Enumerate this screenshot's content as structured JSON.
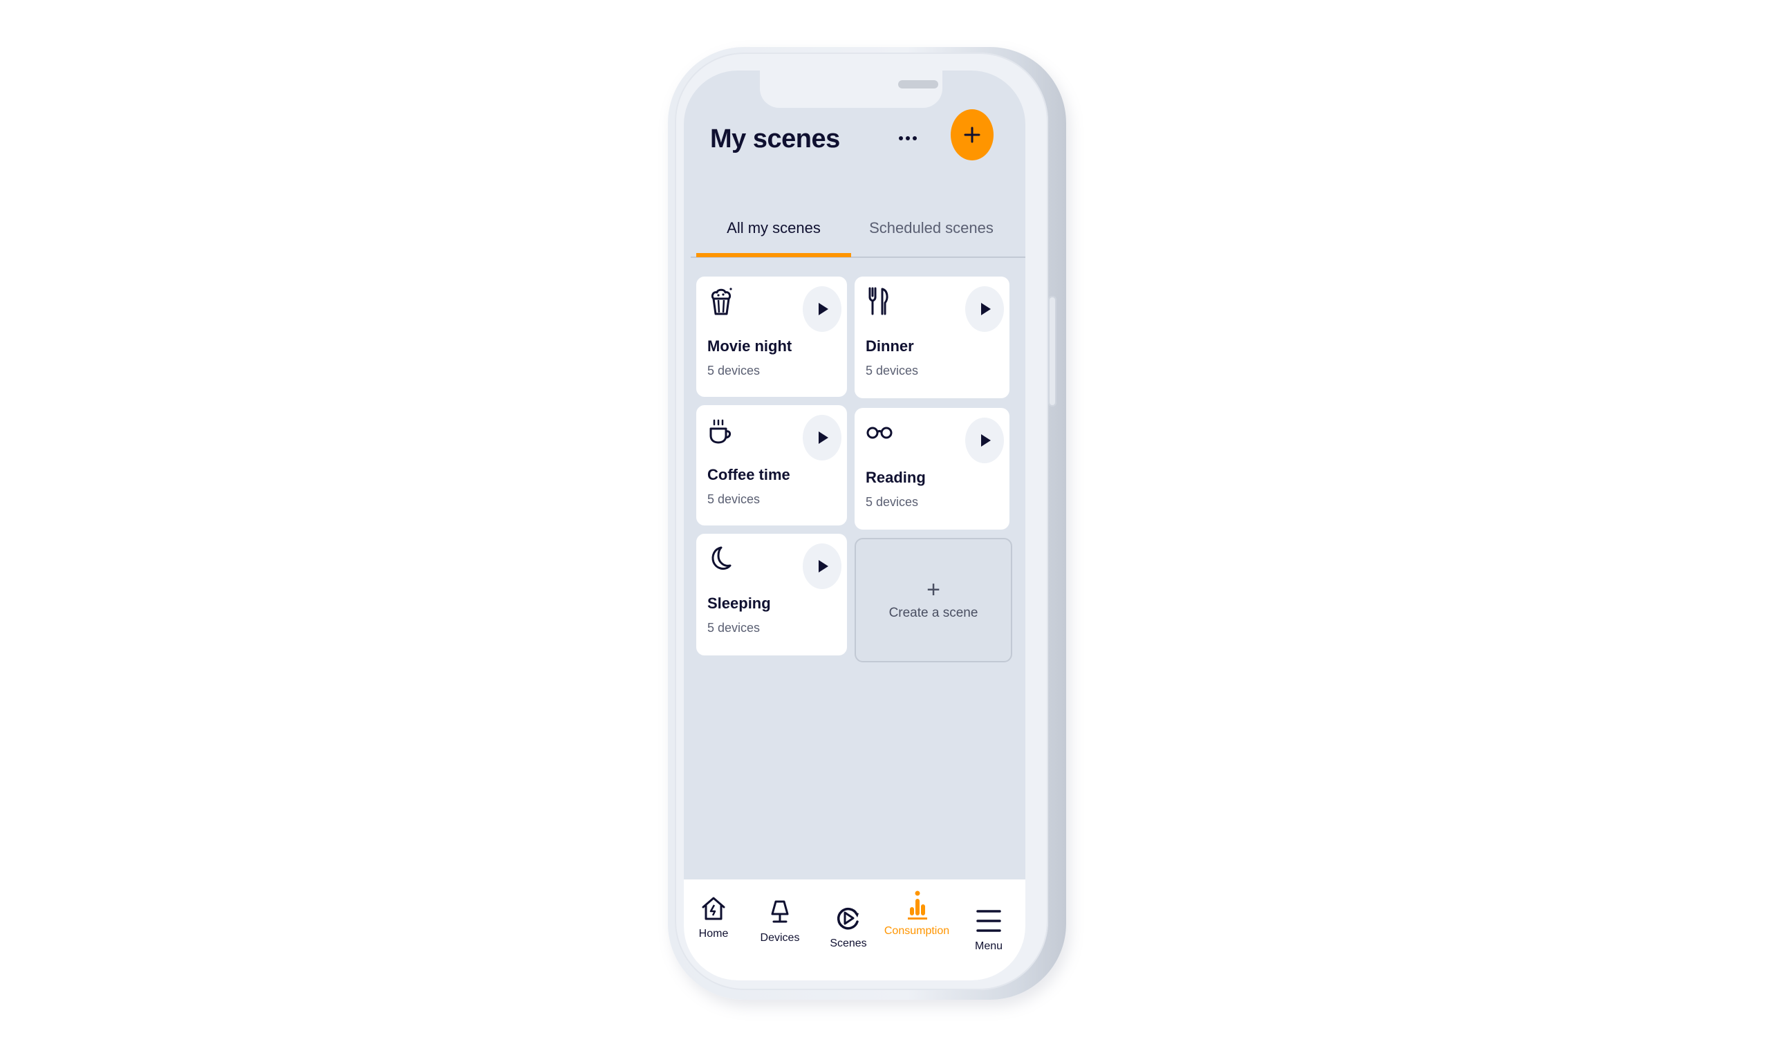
{
  "app": {
    "title": "My scenes",
    "accent_color": "#ff9500",
    "text_color": "#0f1030"
  },
  "header": {
    "more_icon": "more-horizontal-icon",
    "add_icon": "plus-icon"
  },
  "tabs": [
    {
      "label": "All my scenes",
      "active": true
    },
    {
      "label": "Scheduled scenes",
      "active": false
    }
  ],
  "scenes": [
    {
      "name": "Movie night",
      "devices": "5 devices",
      "icon": "popcorn-icon"
    },
    {
      "name": "Dinner",
      "devices": "5 devices",
      "icon": "fork-knife-icon"
    },
    {
      "name": "Coffee time",
      "devices": "5 devices",
      "icon": "coffee-cup-icon"
    },
    {
      "name": "Reading",
      "devices": "5 devices",
      "icon": "glasses-icon"
    },
    {
      "name": "Sleeping",
      "devices": "5 devices",
      "icon": "moon-icon"
    }
  ],
  "create_scene": {
    "plus": "+",
    "label": "Create a scene"
  },
  "bottom_nav": [
    {
      "label": "Home",
      "icon": "home-bolt-icon",
      "active": false
    },
    {
      "label": "Devices",
      "icon": "lamp-icon",
      "active": false
    },
    {
      "label": "Scenes",
      "icon": "scenes-play-icon",
      "active": false
    },
    {
      "label": "Consumption",
      "icon": "bar-chart-icon",
      "active": true
    },
    {
      "label": "Menu",
      "icon": "hamburger-menu-icon",
      "active": false
    }
  ]
}
